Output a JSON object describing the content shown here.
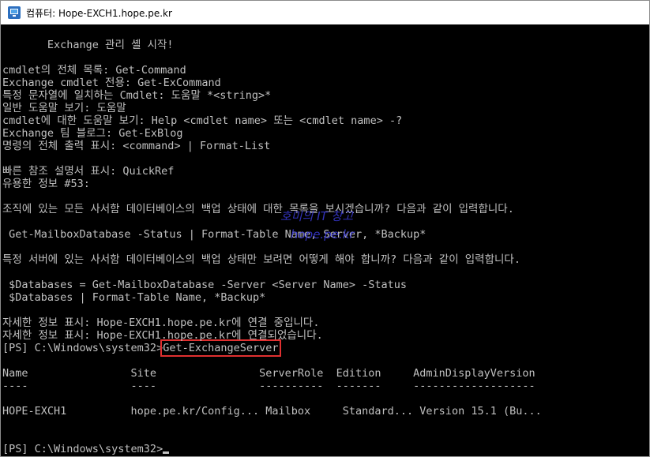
{
  "window": {
    "title": "컴퓨터: Hope-EXCH1.hope.pe.kr",
    "icon": "remote-desktop-icon"
  },
  "console": {
    "lines": [
      "       Exchange 관리 셸 시작!",
      "",
      "cmdlet의 전체 목록: Get-Command",
      "Exchange cmdlet 전용: Get-ExCommand",
      "특정 문자열에 일치하는 Cmdlet: 도움말 *<string>*",
      "일반 도움말 보기: 도움말",
      "cmdlet에 대한 도움말 보기: Help <cmdlet name> 또는 <cmdlet name> -?",
      "Exchange 팀 블로그: Get-ExBlog",
      "명령의 전체 출력 표시: <command> | Format-List",
      "",
      "빠른 참조 설명서 표시: QuickRef",
      "유용한 정보 #53:",
      "",
      "조직에 있는 모든 사서함 데이터베이스의 백업 상태에 대한 목록을 보시겠습니까? 다음과 같이 입력합니다.",
      "",
      " Get-MailboxDatabase -Status | Format-Table Name, Server, *Backup*",
      "",
      "특정 서버에 있는 사서함 데이터베이스의 백업 상태만 보려면 어떻게 해야 합니까? 다음과 같이 입력합니다.",
      "",
      " $Databases = Get-MailboxDatabase -Server <Server Name> -Status",
      " $Databases | Format-Table Name, *Backup*",
      "",
      "자세한 정보 표시: Hope-EXCH1.hope.pe.kr에 연결 중입니다.",
      "자세한 정보 표시: Hope-EXCH1.hope.pe.kr에 연결되었습니다."
    ],
    "prompt": "[PS] C:\\Windows\\system32>",
    "entered_command": "Get-ExchangeServer",
    "table_header": "Name                Site                ServerRole  Edition     AdminDisplayVersion",
    "table_separator": "----                ----                ----------  -------     -------------------",
    "table_row": "HOPE-EXCH1          hope.pe.kr/Config... Mailbox     Standard... Version 15.1 (Bu...",
    "final_prompt": "[PS] C:\\Windows\\system32>"
  },
  "watermark": {
    "line1": "호미의 IT 창고",
    "line2": "hope.pe.kr"
  }
}
